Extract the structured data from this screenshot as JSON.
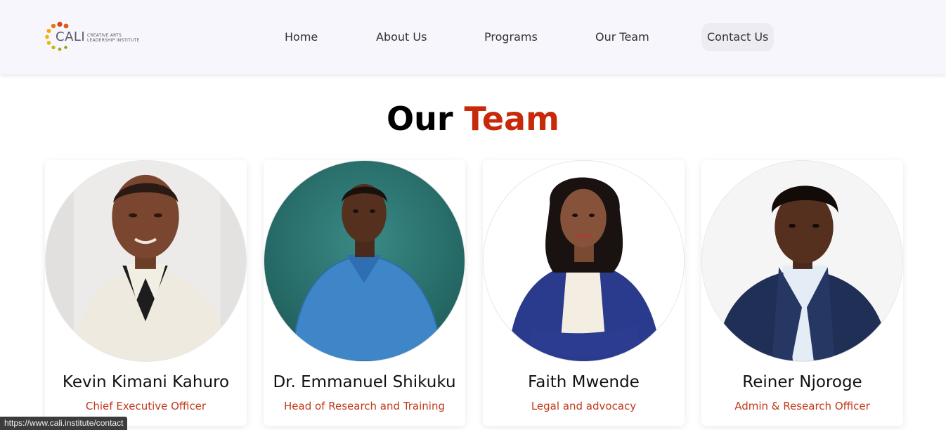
{
  "brand": {
    "name": "CALI",
    "tagline_line1": "CREATIVE ARTS",
    "tagline_line2": "LEADERSHIP INSTITUTE",
    "dot_colors": [
      "#d4471a",
      "#e07a10",
      "#f0a80a",
      "#c9b50a",
      "#8aa012"
    ]
  },
  "nav": {
    "items": [
      {
        "label": "Home"
      },
      {
        "label": "About Us"
      },
      {
        "label": "Programs"
      },
      {
        "label": "Our Team"
      },
      {
        "label": "Contact Us"
      }
    ]
  },
  "section": {
    "title_part1": "Our",
    "title_part2": "Team",
    "accent_color": "#c8290b"
  },
  "team": [
    {
      "name": "Kevin Kimani Kahuro",
      "role": "Chief Executive Officer"
    },
    {
      "name": "Dr. Emmanuel Shikuku",
      "role": "Head of Research and Training"
    },
    {
      "name": "Faith Mwende",
      "role": "Legal and advocacy"
    },
    {
      "name": "Reiner Njoroge",
      "role": "Admin & Research Officer"
    }
  ],
  "status_bar": {
    "url": "https://www.cali.institute/contact"
  }
}
